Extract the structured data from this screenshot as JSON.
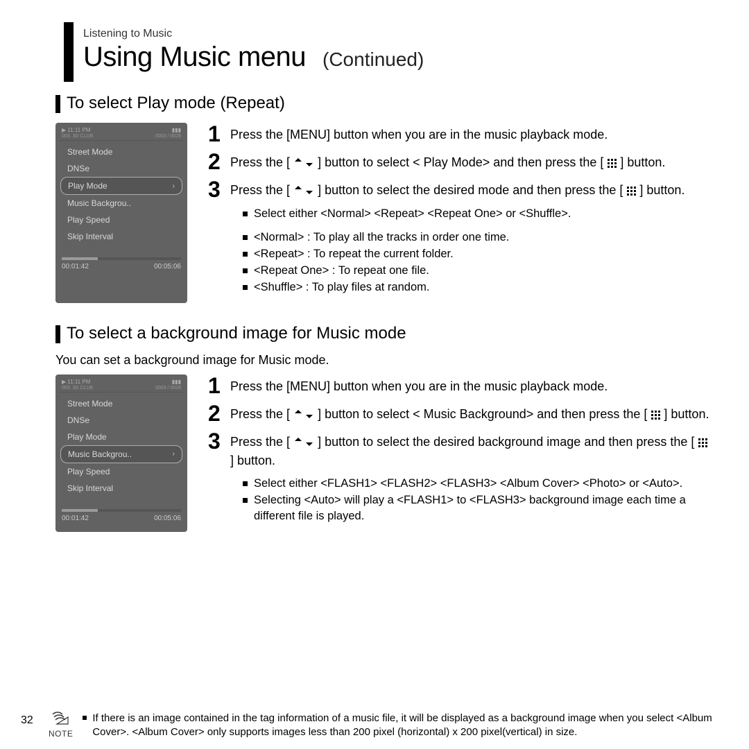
{
  "breadcrumb": "Listening to Music",
  "title": "Using Music menu",
  "title_suffix": "(Continued)",
  "page_number": "32",
  "note_label": "NOTE",
  "section1": {
    "heading": "To select Play mode (Repeat)",
    "device": {
      "status_left": "▶  11:11 PM",
      "status_right": "▮▮▮",
      "track_left": "003. 3D CLUB",
      "track_right": "0003 / 0028",
      "menu": [
        {
          "label": "Street Mode",
          "active": false
        },
        {
          "label": "DNSe",
          "active": false
        },
        {
          "label": "Play Mode",
          "active": true
        },
        {
          "label": "Music Backgrou..",
          "active": false
        },
        {
          "label": "Play Speed",
          "active": false
        },
        {
          "label": "Skip Interval",
          "active": false
        }
      ],
      "time_left": "00:01:42",
      "time_right": "00:05:06"
    },
    "steps": {
      "s1": "Press the [MENU] button when you are in the music playback mode.",
      "s2a": "Press the [",
      "s2b": "] button to select <   Play Mode>  and then press the [",
      "s2c": "] button.",
      "s3a": "Press the [",
      "s3b": "] button   to select the desired mode and then press the [",
      "s3c": "] button."
    },
    "sub1": "Select either <Normal> <Repeat> <Repeat One> or <Shuffle>.",
    "modes": [
      "<Normal> : To play all the tracks in order one time.",
      "<Repeat> : To repeat the current folder.",
      "<Repeat One> : To repeat one file.",
      "<Shuffle> : To play files at random."
    ]
  },
  "section2": {
    "heading": "To select a background image for Music mode",
    "intro": "You can set a background image for Music mode.",
    "device": {
      "status_left": "▶  11:11 PM",
      "status_right": "▮▮▮",
      "track_left": "003. 3D CLUB",
      "track_right": "0003 / 0028",
      "menu": [
        {
          "label": "Street Mode",
          "active": false
        },
        {
          "label": "DNSe",
          "active": false
        },
        {
          "label": "Play Mode",
          "active": false
        },
        {
          "label": "Music Backgrou..",
          "active": true
        },
        {
          "label": "Play Speed",
          "active": false
        },
        {
          "label": "Skip Interval",
          "active": false
        }
      ],
      "time_left": "00:01:42",
      "time_right": "00:05:06"
    },
    "steps": {
      "s1": "Press the [MENU] button when you are in the music playback mode.",
      "s2a": "Press the [",
      "s2b": "] button to select <   Music Background> and then press the [",
      "s2c": "] button.",
      "s3a": "Press the [",
      "s3b": "] button to select the desired background image and then press the [",
      "s3c": "] button."
    },
    "sub": [
      "Select either <FLASH1> <FLASH2> <FLASH3> <Album Cover> <Photo> or <Auto>.",
      "Selecting <Auto> will play a <FLASH1> to <FLASH3> background image each time a different file is played."
    ]
  },
  "footnote": "If there is an image contained in the tag information of a music file, it will be displayed as a background image when you select <Album Cover>. <Album Cover> only supports images less than 200 pixel (horizontal) x 200 pixel(vertical) in size."
}
